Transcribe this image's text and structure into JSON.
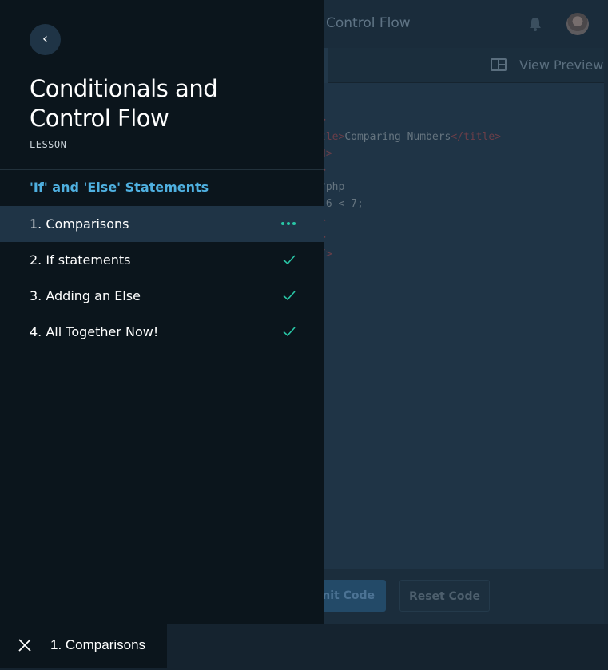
{
  "app": {
    "title": "Control Flow",
    "toolbar": {
      "view_preview_label": "View Preview"
    },
    "code_lines": [
      {
        "pre": "",
        "tag": ">",
        "text": "",
        "post": ""
      },
      {
        "pre": "",
        "tag": "tle>",
        "text": "Comparing Numbers",
        "post": "</title>"
      },
      {
        "pre": "",
        "tag": "d>",
        "text": "",
        "post": ""
      },
      {
        "pre": "",
        "tag": ">",
        "text": "",
        "post": ""
      },
      {
        "pre": "",
        "tag": "",
        "text": "?php",
        "post": ""
      },
      {
        "pre": "",
        "tag": "",
        "text": " 6 < 7;",
        "post": ""
      },
      {
        "pre": "",
        "tag": ">",
        "text": "",
        "post": ""
      },
      {
        "pre": "",
        "tag": ">",
        "text": "",
        "post": ""
      },
      {
        "pre": "",
        "tag": "/>",
        "text": "",
        "post": ""
      }
    ],
    "footer": {
      "submit_label": "mit Code",
      "reset_label": "Reset Code"
    }
  },
  "drawer": {
    "back_glyph": "‹",
    "lesson_title": "Conditionals and Control Flow",
    "lesson_kind": "LESSON",
    "section_title": "'If' and 'Else' Statements",
    "steps": [
      {
        "label": "1. Comparisons",
        "status": "in-progress"
      },
      {
        "label": "2. If statements",
        "status": "complete"
      },
      {
        "label": "3. Adding an Else",
        "status": "complete"
      },
      {
        "label": "4. All Together Now!",
        "status": "complete"
      }
    ]
  },
  "bottom_bar": {
    "current_step": "1. Comparisons"
  },
  "colors": {
    "accent_blue": "#4fb0e0",
    "complete_green": "#29c6a6",
    "drawer_bg": "#0b151c",
    "active_row_bg": "#1f3446"
  },
  "icons": {
    "back": "chevron-left-icon",
    "bell": "bell-icon",
    "preview": "layout-split-icon",
    "in_progress": "more-dots-icon",
    "complete": "check-icon",
    "close": "close-icon"
  }
}
